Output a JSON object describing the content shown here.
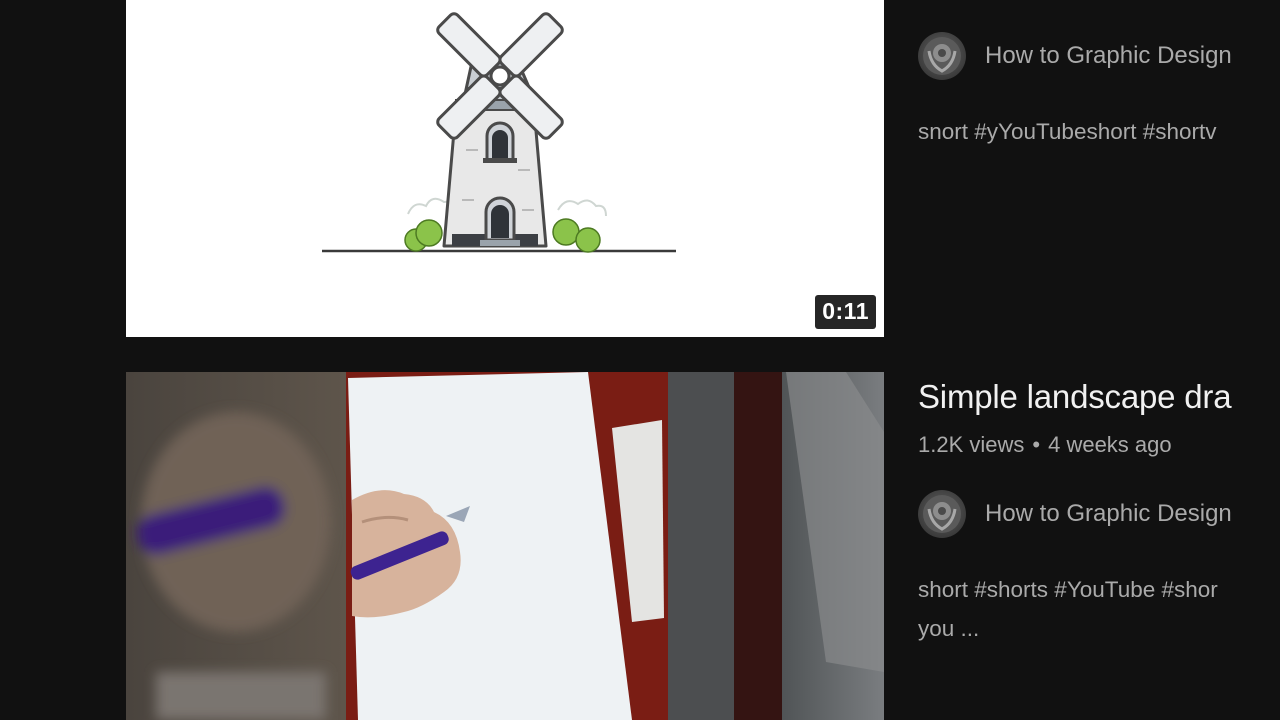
{
  "videos": [
    {
      "duration": "0:11",
      "thumbnail_icon": "windmill-drawing",
      "channel": "How to Graphic Design",
      "description": "snort #yYouTubeshort #shortv"
    },
    {
      "thumbnail_icon": "hand-drawing-on-paper",
      "title": "Simple landscape dra",
      "views": "1.2K views",
      "separator": "•",
      "age": "4 weeks ago",
      "channel": "How to Graphic Design",
      "description_lines": [
        "short #shorts #YouTube #shor",
        "you ..."
      ]
    }
  ],
  "colors": {
    "background": "#111111",
    "primary_text": "#f1f1f1",
    "secondary_text": "#aaaaaa"
  }
}
